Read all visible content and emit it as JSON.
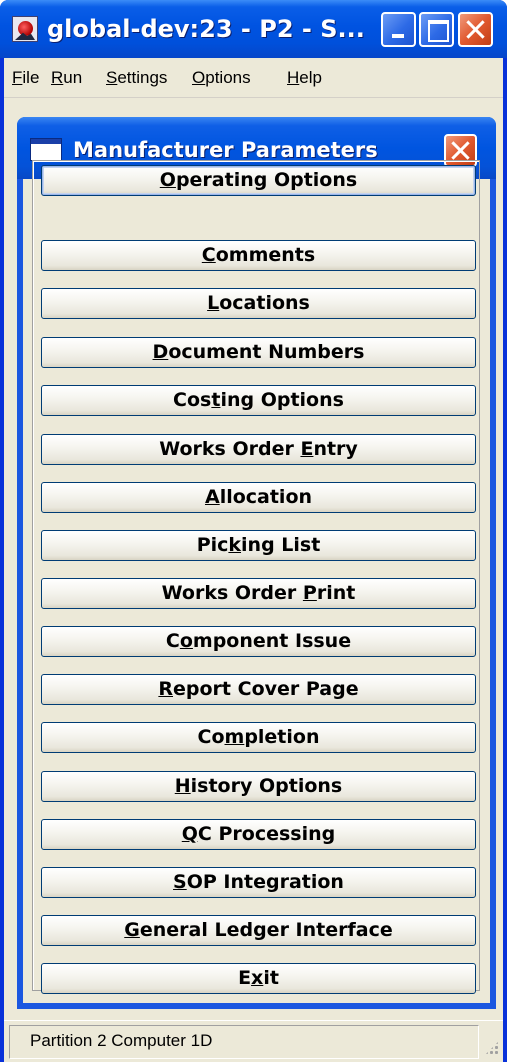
{
  "window": {
    "title": "global-dev:23 - P2 - S...",
    "icon": "app-icon"
  },
  "menu": {
    "items": [
      "File",
      "Run",
      "Settings",
      "Options",
      "Help"
    ]
  },
  "dialog": {
    "title": "Manufacturer Parameters",
    "buttons": [
      {
        "label": "Operating Options",
        "mnemonic_index": 0
      },
      {
        "label": "Comments",
        "mnemonic_index": 0
      },
      {
        "label": "Locations",
        "mnemonic_index": 0
      },
      {
        "label": "Document Numbers",
        "mnemonic_index": 0
      },
      {
        "label": "Costing Options",
        "mnemonic_index": 3
      },
      {
        "label": "Works Order Entry",
        "mnemonic_index": 12
      },
      {
        "label": "Allocation",
        "mnemonic_index": 0
      },
      {
        "label": "Picking List",
        "mnemonic_index": 3
      },
      {
        "label": "Works Order Print",
        "mnemonic_index": 12
      },
      {
        "label": "Component Issue",
        "mnemonic_index": 1
      },
      {
        "label": "Report Cover Page",
        "mnemonic_index": 0
      },
      {
        "label": "Completion",
        "mnemonic_index": 2
      },
      {
        "label": "History Options",
        "mnemonic_index": 0
      },
      {
        "label": "QC Processing",
        "mnemonic_index": 0
      },
      {
        "label": "SOP Integration",
        "mnemonic_index": 0
      },
      {
        "label": "General Ledger Interface",
        "mnemonic_index": 0
      },
      {
        "label": "Exit",
        "mnemonic_index": 1
      }
    ]
  },
  "status": {
    "text": "Partition 2 Computer 1D"
  },
  "colors": {
    "titlebar": "#0055e0",
    "face": "#ece9d8",
    "button_border": "#003c74"
  }
}
